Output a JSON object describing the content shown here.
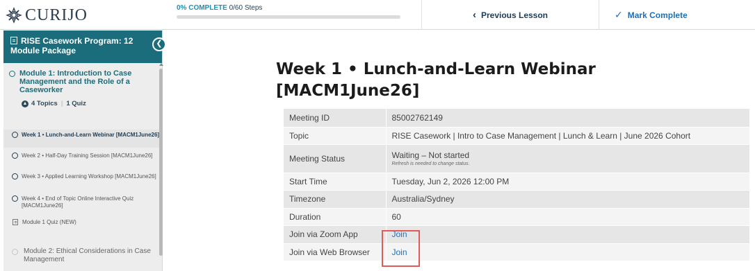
{
  "brand": {
    "name": "CURIJO"
  },
  "progress": {
    "percent_label": "0% COMPLETE",
    "steps_label": "0/60 Steps",
    "fraction": 0.0
  },
  "nav": {
    "previous_label": "Previous Lesson",
    "complete_label": "Mark Complete"
  },
  "sidebar": {
    "course_title": "RISE Casework Program: 12 Module Package",
    "module1": {
      "title": "Module 1: Introduction to Case Management and the Role of a Caseworker",
      "topics_label": "4 Topics",
      "quiz_label": "1 Quiz"
    },
    "lessons": [
      {
        "label": "Week 1 • Lunch-and-Learn Webinar [MACM1June26]",
        "active": true
      },
      {
        "label": "Week 2 • Half-Day Training Session [MACM1June26]"
      },
      {
        "label": "Week 3 • Applied Learning Workshop [MACM1June26]"
      },
      {
        "label": "Week 4 • End of Topic Online Interactive Quiz [MACM1June26]"
      },
      {
        "label": "Module 1 Quiz (NEW)",
        "type": "quiz"
      }
    ],
    "module2": {
      "title": "Module 2: Ethical Considerations in Case Management"
    }
  },
  "main": {
    "title": "Week 1 • Lunch-and-Learn Webinar [MACM1June26]",
    "table": [
      {
        "label": "Meeting ID",
        "value": "85002762149"
      },
      {
        "label": "Topic",
        "value": "RISE Casework | Intro to Case Management | Lunch & Learn | June 2026 Cohort"
      },
      {
        "label": "Meeting Status",
        "value": "Waiting – Not started",
        "note": "Refresh is needed to change status."
      },
      {
        "label": "Start Time",
        "value": "Tuesday, Jun 2, 2026 12:00 PM"
      },
      {
        "label": "Timezone",
        "value": "Australia/Sydney"
      },
      {
        "label": "Duration",
        "value": "60"
      },
      {
        "label": "Join via Zoom App",
        "value": "Join",
        "link": true
      },
      {
        "label": "Join via Web Browser",
        "value": "Join",
        "link": true
      }
    ]
  },
  "colors": {
    "teal": "#1c6d7c",
    "link": "#1f6fb5",
    "highlight": "#e05a5a"
  }
}
